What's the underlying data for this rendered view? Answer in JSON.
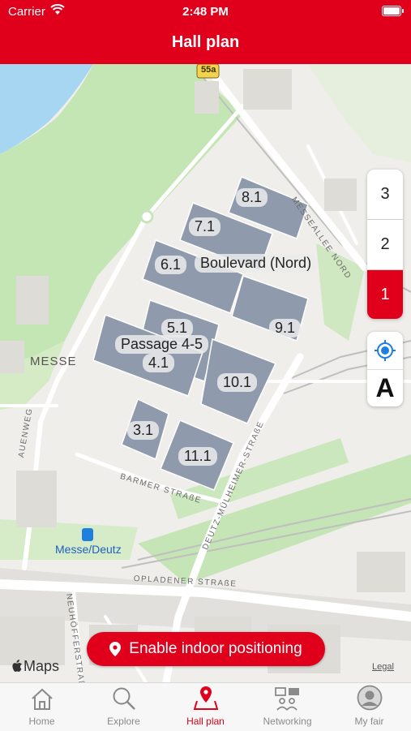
{
  "status_bar": {
    "carrier": "Carrier",
    "time": "2:48 PM"
  },
  "header": {
    "title": "Hall plan"
  },
  "map": {
    "road_shield": "55a",
    "halls": [
      {
        "label": "8.1"
      },
      {
        "label": "7.1"
      },
      {
        "label": "6.1"
      },
      {
        "label": "Boulevard (Nord)"
      },
      {
        "label": "9.1"
      },
      {
        "label": "5.1"
      },
      {
        "label": "Passage 4-5"
      },
      {
        "label": "4.1"
      },
      {
        "label": "10.1"
      },
      {
        "label": "3.1"
      },
      {
        "label": "11.1"
      }
    ],
    "streets": {
      "messeallee": "MESSEALLEE NORD",
      "auenweg": "AUENWEG",
      "barmer": "BARMER STRAßE",
      "deutz": "DEUTZ-MÜLHEIMER-STRAßE",
      "opladener": "OPLADENER STRAßE",
      "neuhoeffer": "NEUHÖFFERSTRAßE"
    },
    "area_label": "MESSE",
    "station_label": "Messe/Deutz",
    "attribution": "Maps",
    "legal": "Legal"
  },
  "floors": {
    "items": [
      "3",
      "2",
      "1"
    ],
    "selected": "1"
  },
  "controls": {
    "compass_label": "A"
  },
  "indoor_button": {
    "label": "Enable indoor positioning"
  },
  "tabs": [
    {
      "label": "Home",
      "icon": "home-icon"
    },
    {
      "label": "Explore",
      "icon": "search-icon"
    },
    {
      "label": "Hall plan",
      "icon": "map-pin-icon"
    },
    {
      "label": "Networking",
      "icon": "networking-icon"
    },
    {
      "label": "My fair",
      "icon": "person-icon"
    }
  ],
  "active_tab": "Hall plan",
  "colors": {
    "brand_red": "#e0001b",
    "hall_fill": "#8f9bad",
    "park_green": "#bfe5b0",
    "water": "#a7d6f2"
  }
}
